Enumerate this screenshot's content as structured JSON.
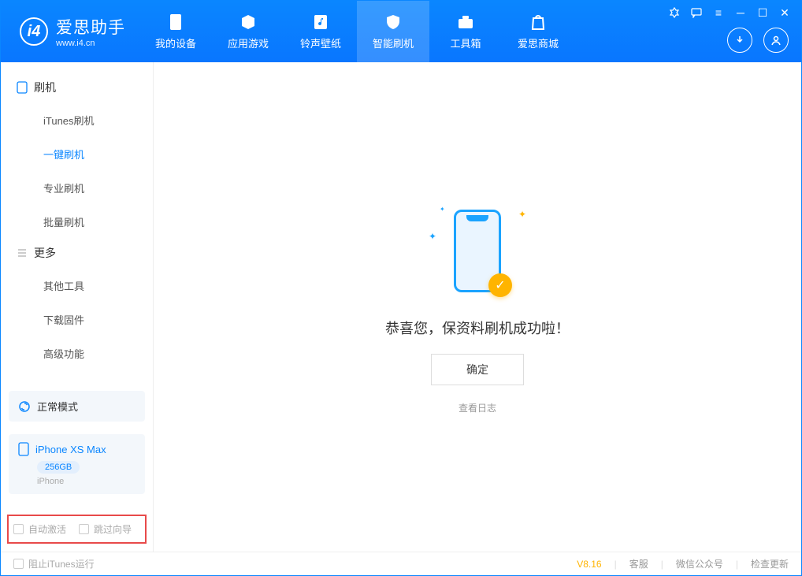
{
  "app": {
    "title": "爱思助手",
    "subtitle": "www.i4.cn"
  },
  "nav": {
    "items": [
      {
        "label": "我的设备"
      },
      {
        "label": "应用游戏"
      },
      {
        "label": "铃声壁纸"
      },
      {
        "label": "智能刷机"
      },
      {
        "label": "工具箱"
      },
      {
        "label": "爱思商城"
      }
    ]
  },
  "sidebar": {
    "group1": "刷机",
    "items1": [
      "iTunes刷机",
      "一键刷机",
      "专业刷机",
      "批量刷机"
    ],
    "group2": "更多",
    "items2": [
      "其他工具",
      "下载固件",
      "高级功能"
    ],
    "mode": "正常模式",
    "device_name": "iPhone XS Max",
    "device_capacity": "256GB",
    "device_type": "iPhone",
    "chk_auto_activate": "自动激活",
    "chk_skip_guide": "跳过向导"
  },
  "main": {
    "success": "恭喜您，保资料刷机成功啦！",
    "ok": "确定",
    "view_log": "查看日志"
  },
  "footer": {
    "block_itunes": "阻止iTunes运行",
    "version": "V8.16",
    "support": "客服",
    "wechat": "微信公众号",
    "update": "检查更新"
  }
}
